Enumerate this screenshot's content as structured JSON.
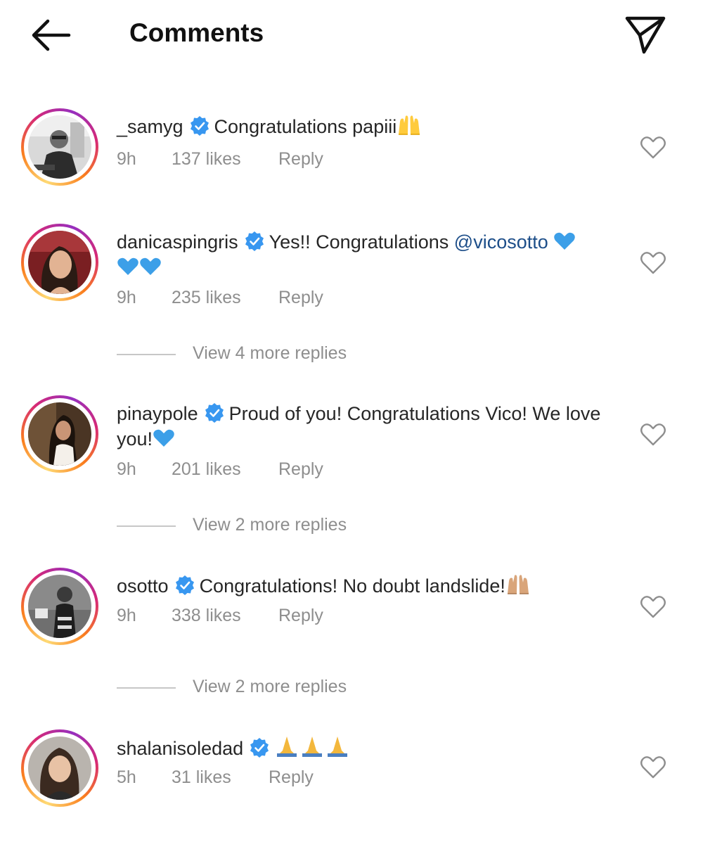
{
  "header": {
    "title": "Comments",
    "back_icon": "arrow-left-icon",
    "send_icon": "paper-plane-icon"
  },
  "colors": {
    "text": "#262626",
    "muted": "#8e8e8e",
    "verified": "#3897f0",
    "mention": "#1d4e89",
    "blue_heart": "#3c9fe8"
  },
  "comments": [
    {
      "username": "_samyg",
      "verified": true,
      "text": "Congratulations papiii",
      "text_after": "",
      "mention": "",
      "emoji_after": "raising-hands",
      "time": "9h",
      "likes": "137 likes",
      "reply": "Reply",
      "view_more": ""
    },
    {
      "username": "danicaspingris",
      "verified": true,
      "text": "Yes!! Congratulations ",
      "mention": "@vicosotto",
      "emoji_after": "blue-hearts-x3",
      "time": "9h",
      "likes": "235 likes",
      "reply": "Reply",
      "view_more": "View 4 more replies"
    },
    {
      "username": "pinaypole",
      "verified": true,
      "text": "Proud of you! Congratulations Vico! We love you!",
      "mention": "",
      "emoji_after": "blue-heart",
      "time": "9h",
      "likes": "201 likes",
      "reply": "Reply",
      "view_more": "View 2 more replies"
    },
    {
      "username": "osotto",
      "verified": true,
      "text": "Congratulations! No doubt landslide!",
      "mention": "",
      "emoji_after": "raising-hands-medium",
      "time": "9h",
      "likes": "338 likes",
      "reply": "Reply",
      "view_more": "View 2 more replies"
    },
    {
      "username": "shalanisoledad",
      "verified": true,
      "text": "",
      "mention": "",
      "emoji_after": "folded-hands-x3",
      "time": "5h",
      "likes": "31 likes",
      "reply": "Reply",
      "view_more": ""
    }
  ]
}
